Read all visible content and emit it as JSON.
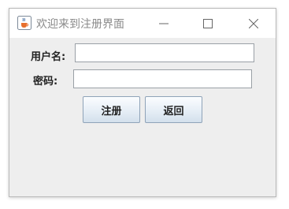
{
  "window": {
    "title": "欢迎来到注册界面",
    "controls": {
      "minimize": "minimize",
      "maximize": "maximize",
      "close": "close"
    }
  },
  "form": {
    "username_label": "用户名:",
    "username_value": "",
    "password_label": "密码:",
    "password_value": ""
  },
  "buttons": {
    "register": "注册",
    "back": "返回"
  },
  "icons": {
    "app": "java-coffee-cup-icon",
    "minimize": "minimize-icon",
    "maximize": "maximize-icon",
    "close": "close-icon"
  }
}
